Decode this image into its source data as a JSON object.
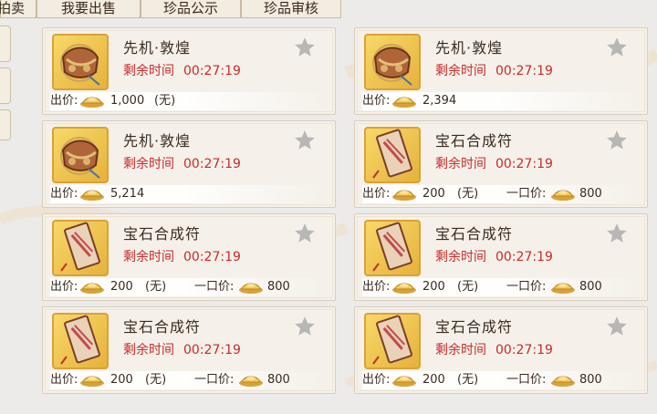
{
  "tabs": [
    "拍卖",
    "我要出售",
    "珍品公示",
    "珍品审核"
  ],
  "labels": {
    "remaining": "剩余时间",
    "price": "出价:",
    "none": "(无)",
    "buyout": "一口价:"
  },
  "items": [
    {
      "name": "先机·敦煌",
      "time": "00:27:19",
      "price": "1,000",
      "none": "(无)",
      "buyout": "",
      "type": "pouch"
    },
    {
      "name": "先机·敦煌",
      "time": "00:27:19",
      "price": "2,394",
      "none": "",
      "buyout": "",
      "type": "pouch"
    },
    {
      "name": "先机·敦煌",
      "time": "00:27:19",
      "price": "5,214",
      "none": "",
      "buyout": "",
      "type": "pouch"
    },
    {
      "name": "宝石合成符",
      "time": "00:27:19",
      "price": "200",
      "none": "(无)",
      "buyout": "800",
      "type": "talisman"
    },
    {
      "name": "宝石合成符",
      "time": "00:27:19",
      "price": "200",
      "none": "(无)",
      "buyout": "800",
      "type": "talisman"
    },
    {
      "name": "宝石合成符",
      "time": "00:27:19",
      "price": "200",
      "none": "(无)",
      "buyout": "800",
      "type": "talisman"
    },
    {
      "name": "宝石合成符",
      "time": "00:27:19",
      "price": "200",
      "none": "(无)",
      "buyout": "800",
      "type": "talisman"
    },
    {
      "name": "宝石合成符",
      "time": "00:27:19",
      "price": "200",
      "none": "(无)",
      "buyout": "800",
      "type": "talisman"
    }
  ],
  "colors": {
    "time": "#c92a2a",
    "text": "#3a2b1f",
    "thumb_border": "#d9a237",
    "star": "#b9b7b5"
  },
  "icons": {
    "favorite": "star-icon",
    "currency": "gold-ingot-icon"
  }
}
